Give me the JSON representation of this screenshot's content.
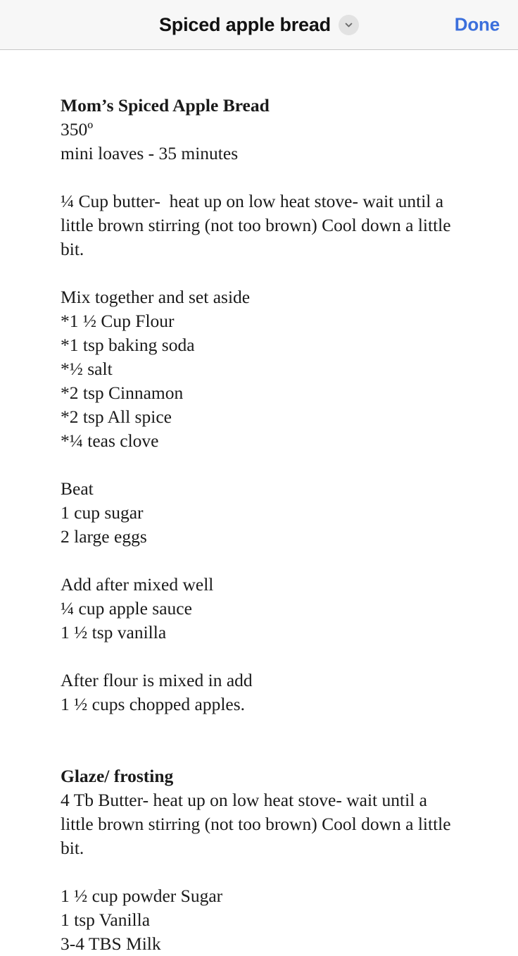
{
  "navbar": {
    "title": "Spiced apple bread",
    "chevron_icon": "chevron-down-icon",
    "done_label": "Done",
    "accent_color": "#3b6fdc",
    "background_color": "#f7f7f7",
    "separator_color": "#c8c8c8"
  },
  "note": {
    "heading": "Mom’s Spiced Apple Bread",
    "temperature": "350º",
    "pan_and_time": "mini loaves - 35 minutes",
    "butter_step": "¼ Cup butter-  heat up on low heat stove- wait until a little brown stirring (not too brown) Cool down a little bit.",
    "dry_heading": "Mix together and set aside",
    "dry_ingredients": [
      "*1 ½ Cup Flour",
      "*1 tsp baking soda",
      "*½ salt",
      "*2 tsp Cinnamon",
      "*2 tsp All spice",
      "*¼ teas clove"
    ],
    "beat_heading": "Beat",
    "beat_ingredients": [
      "1 cup sugar",
      "2 large eggs"
    ],
    "add_heading": "Add after mixed well",
    "add_ingredients": [
      "¼ cup apple sauce",
      "1 ½ tsp vanilla"
    ],
    "flour_heading": "After flour is mixed in add",
    "flour_ingredients": [
      "1 ½ cups chopped apples."
    ],
    "glaze_heading": "Glaze/ frosting",
    "glaze_step": "4 Tb Butter- heat up on low heat stove- wait until a little brown stirring (not too brown) Cool down a little bit.",
    "glaze_ingredients": [
      "1 ½ cup powder Sugar",
      "1 tsp Vanilla",
      "3-4 TBS Milk"
    ],
    "text_color": "#1a1a1a"
  }
}
